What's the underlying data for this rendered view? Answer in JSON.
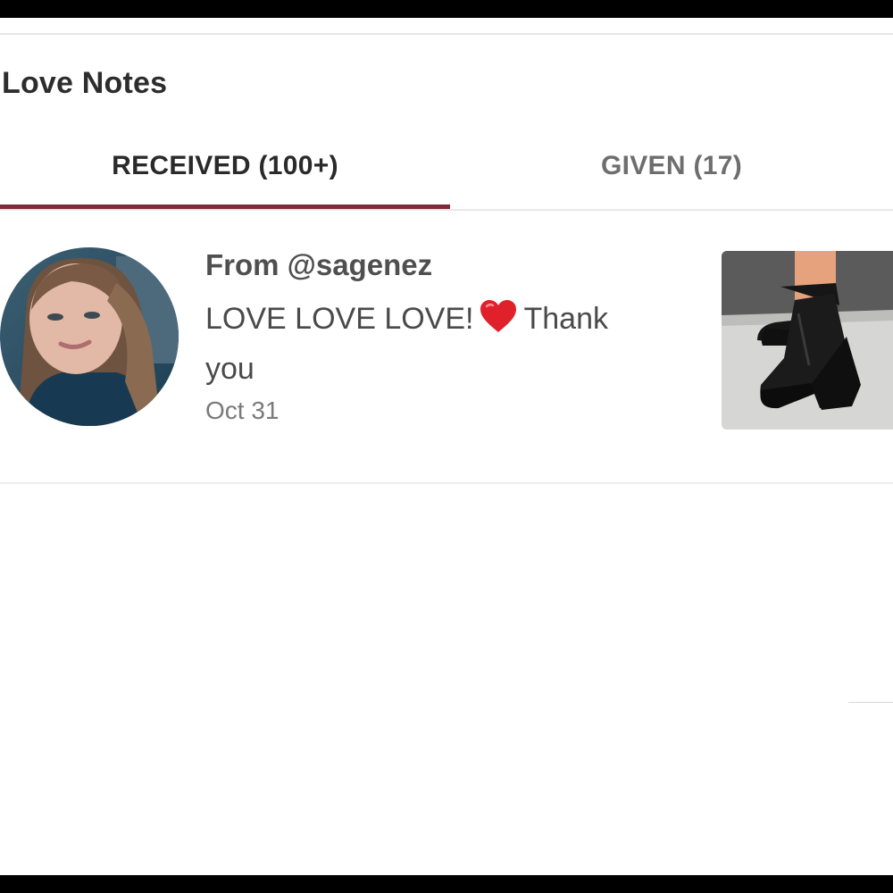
{
  "page": {
    "title": "Love Notes"
  },
  "tabs": [
    {
      "label": "RECEIVED (100+)",
      "active": true
    },
    {
      "label": "GIVEN (17)",
      "active": false
    }
  ],
  "notes": [
    {
      "from": "From @sagenez",
      "message_before": "LOVE LOVE LOVE!",
      "emoji": "heart-icon",
      "message_after": "Thank you",
      "date": "Oct 31"
    }
  ],
  "colors": {
    "accent": "#7b2c38",
    "heart": "#e0202b"
  }
}
